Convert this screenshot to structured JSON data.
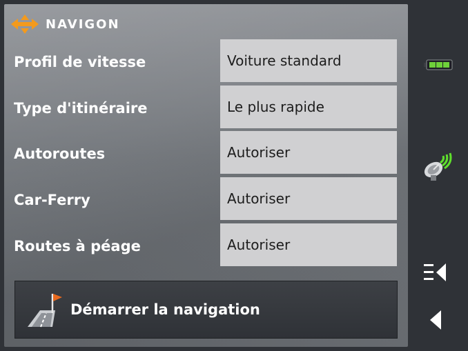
{
  "brand": {
    "name": "NAVIGON",
    "logo_icon": "navigon-arrows-logo"
  },
  "settings": [
    {
      "label": "Profil de vitesse",
      "value": "Voiture standard"
    },
    {
      "label": "Type d'itinéraire",
      "value": "Le plus rapide"
    },
    {
      "label": "Autoroutes",
      "value": "Autoriser"
    },
    {
      "label": "Car-Ferry",
      "value": "Autoriser"
    },
    {
      "label": "Routes à péage",
      "value": "Autoriser"
    }
  ],
  "start_button": {
    "label": "Démarrer la navigation",
    "icon": "navigation-flag-road-icon"
  },
  "sidebar": {
    "battery_icon": "battery-icon",
    "gps_icon": "gps-satellite-icon",
    "menu_icon": "menu-back-icon",
    "back_icon": "back-arrow-icon"
  },
  "colors": {
    "background_dark": "#2f3237",
    "value_cell": "#d0d0d2",
    "logo_orange": "#f39a1d",
    "battery_green": "#6fd13a",
    "signal_green": "#5fe02c"
  }
}
